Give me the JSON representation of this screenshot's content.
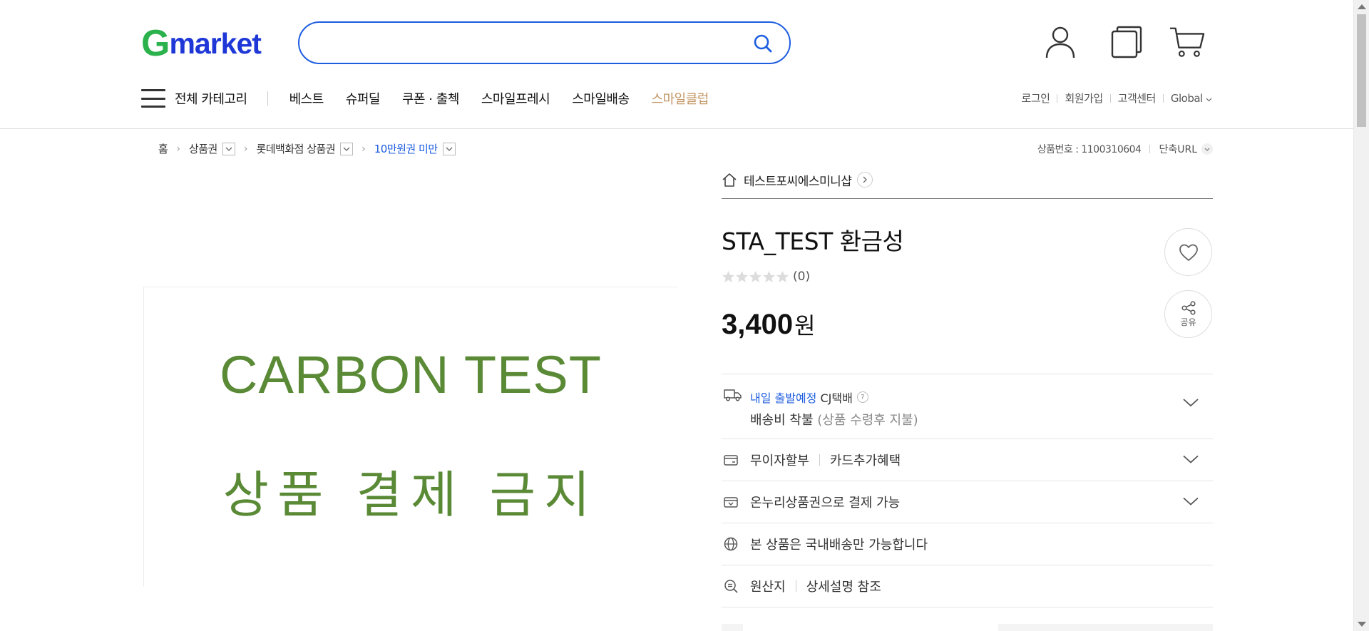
{
  "header": {
    "logo_g": "G",
    "logo_rest": "market",
    "search_placeholder": "",
    "icons": [
      "user-icon",
      "recent-items-icon",
      "cart-icon"
    ]
  },
  "gnb": {
    "all_category": "전체 카테고리",
    "menu": [
      "베스트",
      "슈퍼딜",
      "쿠폰 · 출첵",
      "스마일프레시",
      "스마일배송",
      "스마일클럽"
    ]
  },
  "util": {
    "login": "로그인",
    "signup": "회원가입",
    "support": "고객센터",
    "global": "Global"
  },
  "breadcrumb": {
    "home": "홈",
    "level1": "상품권",
    "level2": "롯데백화점 상품권",
    "level3": "10만원권 미만"
  },
  "product_number": {
    "label": "상품번호 : 1100310604",
    "short_url": "단축URL"
  },
  "product_image": {
    "line1": "CARBON TEST",
    "line2": "상품 결제 금지",
    "text_color": "#5a8a36"
  },
  "seller": {
    "name": "테스트포씨에스미니샵"
  },
  "product": {
    "title": "STA_TEST 환금성",
    "rating_count": "(0)",
    "stars_filled": 0,
    "stars_total": 5,
    "price": "3,400",
    "currency": "원"
  },
  "actions": {
    "share_label": "공유"
  },
  "shipping": {
    "dispatch": "내일 출발예정",
    "carrier": "CJ택배",
    "help": "?",
    "fee": "배송비 착불",
    "fee_note": "(상품 수령후 지불)"
  },
  "rows": {
    "installment": "무이자할부",
    "card_benefit": "카드추가혜택",
    "onnuri": "온누리상품권으로 결제 가능",
    "domestic": "본 상품은 국내배송만 가능합니다",
    "origin_label": "원산지",
    "origin_value": "상세설명 참조"
  },
  "colors": {
    "brand_green": "#2bb24c",
    "brand_blue": "#1e37d6",
    "accent_blue": "#1d5de0",
    "club_gold": "#c29564"
  }
}
